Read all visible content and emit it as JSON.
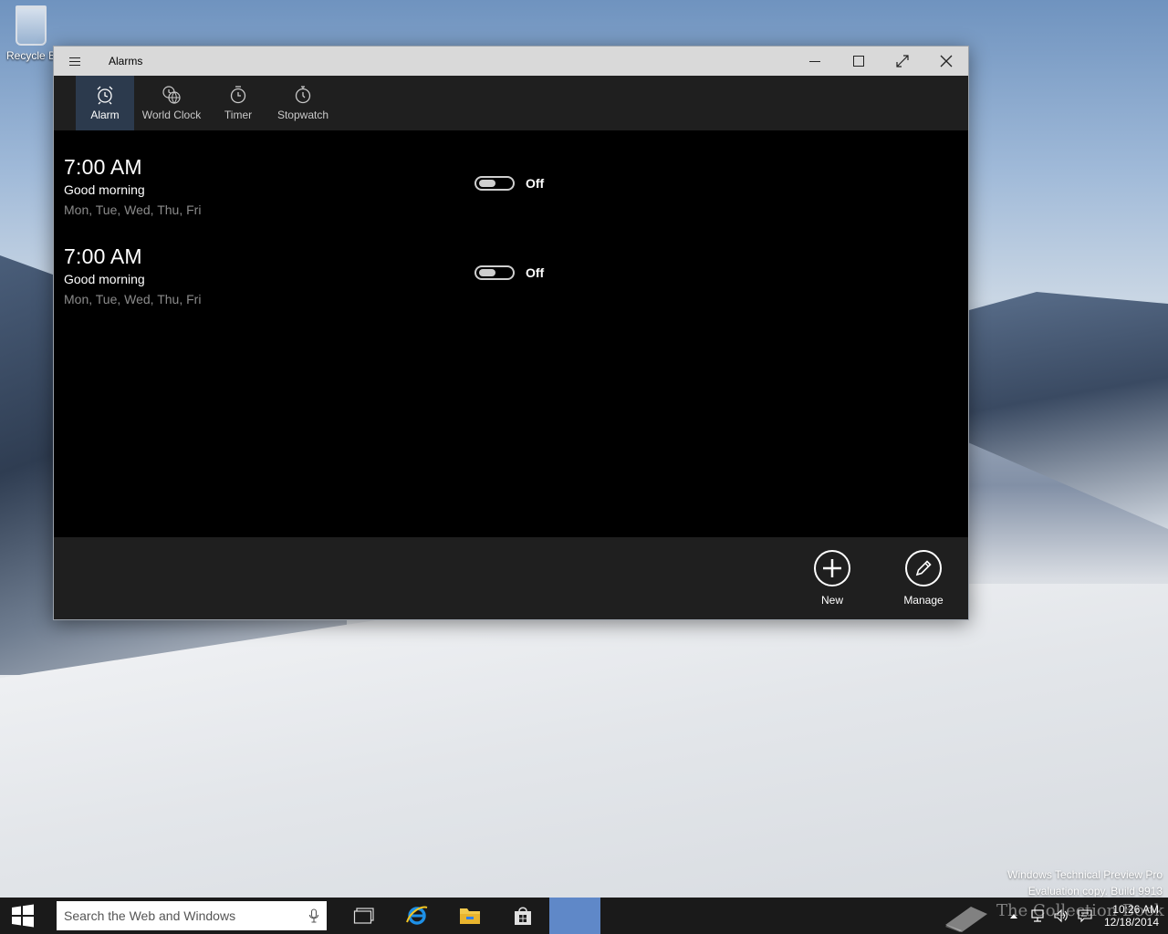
{
  "desktop": {
    "recycle_bin_label": "Recycle B",
    "watermark_line1": "Windows Technical Preview Pro",
    "watermark_line2": "Evaluation copy. Build 9913",
    "overlay_text": "The Collection Book"
  },
  "window": {
    "title": "Alarms"
  },
  "nav": {
    "tabs": [
      {
        "label": "Alarm",
        "icon": "alarm-clock-icon",
        "active": true
      },
      {
        "label": "World Clock",
        "icon": "world-clock-icon",
        "active": false
      },
      {
        "label": "Timer",
        "icon": "timer-icon",
        "active": false
      },
      {
        "label": "Stopwatch",
        "icon": "stopwatch-icon",
        "active": false
      }
    ]
  },
  "alarms": [
    {
      "time": "7:00 AM",
      "name": "Good morning",
      "days": "Mon, Tue, Wed, Thu, Fri",
      "state": "Off"
    },
    {
      "time": "7:00 AM",
      "name": "Good morning",
      "days": "Mon, Tue, Wed, Thu, Fri",
      "state": "Off"
    }
  ],
  "app_bar": {
    "new_label": "New",
    "manage_label": "Manage"
  },
  "taskbar": {
    "search_placeholder": "Search the Web and Windows",
    "time": "10:26 AM",
    "date": "12/18/2014"
  },
  "colors": {
    "active_tab": "#2c3a4d",
    "taskbar_active": "#5f88c8"
  }
}
